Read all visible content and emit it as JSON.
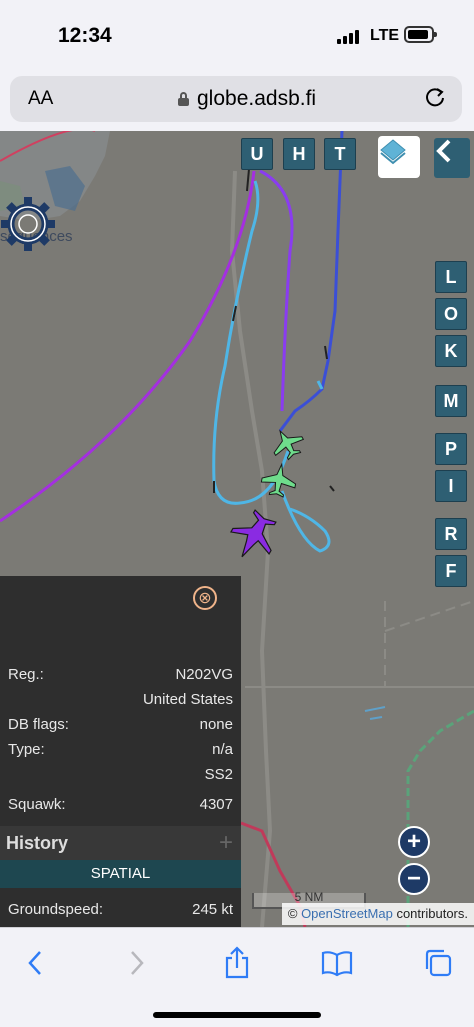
{
  "status_bar": {
    "time": "12:34",
    "network": "LTE"
  },
  "browser": {
    "font_size_label": "AA",
    "domain": "globe.adsb.fi"
  },
  "map": {
    "place_label": "sequences",
    "top_buttons": [
      "U",
      "H",
      "T"
    ],
    "side_buttons": [
      "L",
      "O",
      "K",
      "M",
      "P",
      "I",
      "R",
      "F"
    ],
    "zoom_in": "+",
    "zoom_out": "−",
    "scale_label": "5 NM",
    "attribution_symbol": "©",
    "attribution_osm": "OpenStreetMap",
    "attribution_rest": " contributors.",
    "colors": {
      "trail_purple": "#a42fe0",
      "trail_light_blue": "#4fb6e6",
      "trail_blue": "#3b4fd6",
      "plane_green": "#6fdc8c",
      "plane_purple": "#8a2be2"
    }
  },
  "info_panel": {
    "close_icon": "⊗",
    "rows": [
      {
        "key": "Reg.:",
        "value": "N202VG"
      },
      {
        "key": "",
        "value": "United States"
      },
      {
        "key": "DB flags:",
        "value": "none"
      },
      {
        "key": "Type:",
        "value": "n/a"
      },
      {
        "key": "",
        "value": "SS2"
      },
      {
        "key": "Squawk:",
        "value": "4307"
      }
    ],
    "history_label": "History",
    "history_plus": "+",
    "spatial_label": "SPATIAL",
    "groundspeed": {
      "key": "Groundspeed:",
      "value": "245 kt"
    }
  }
}
